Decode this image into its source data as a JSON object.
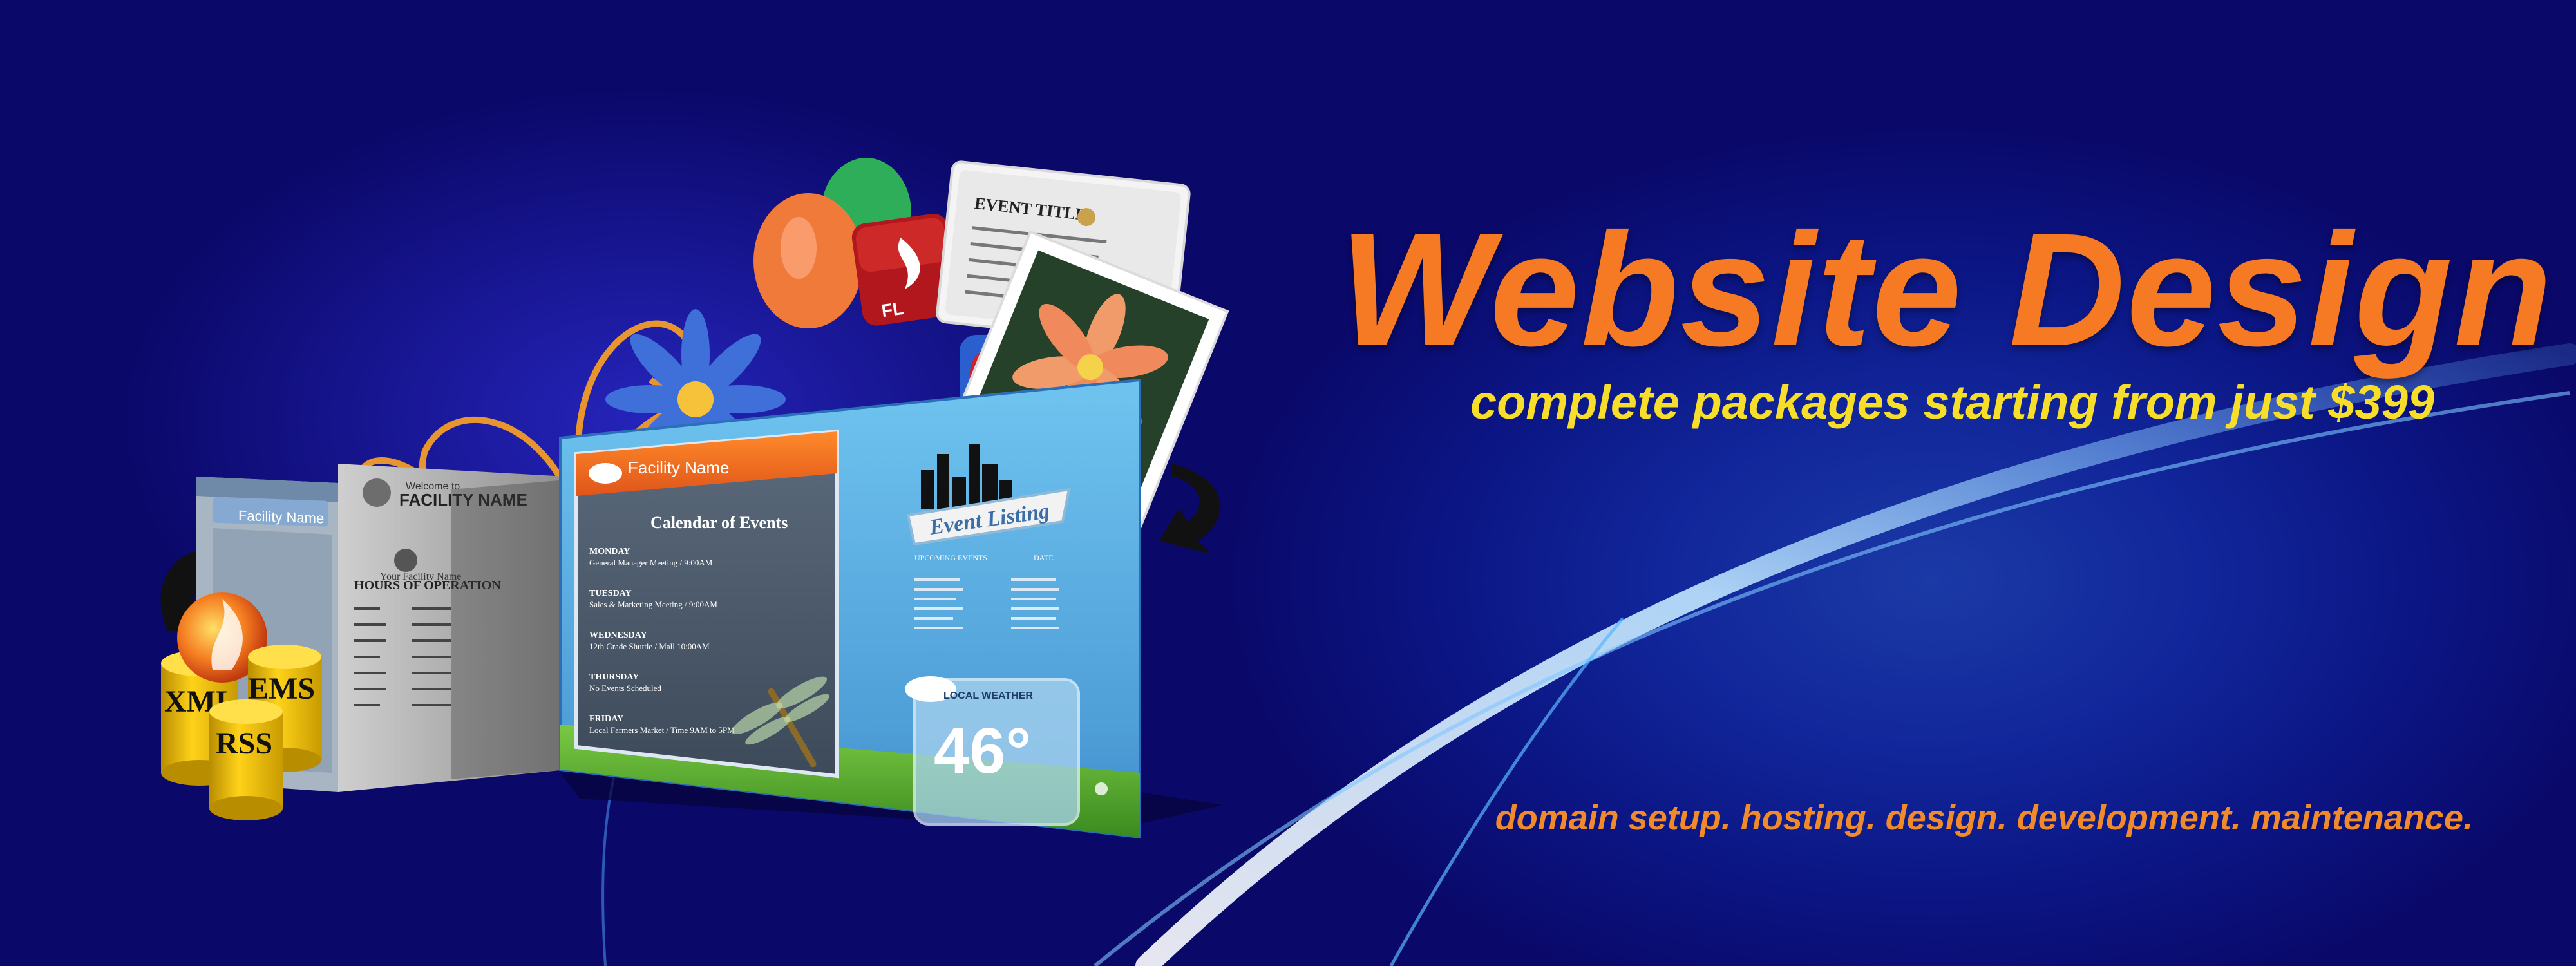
{
  "hero": {
    "headline": "Website Design",
    "subheadline": "complete packages starting from just $399",
    "services": "domain setup. hosting. design. development. maintenance."
  },
  "collage": {
    "tags": [
      "XML",
      "EMS",
      "RSS"
    ],
    "panel1": {
      "name": "Facility Name"
    },
    "panel2": {
      "welcome": "Welcome to",
      "name": "FACILITY NAME",
      "your_name": "Your Facility Name",
      "hours_title": "HOURS OF OPERATION"
    },
    "main_panel": {
      "name": "Facility Name",
      "calendar_title": "Calendar of Events",
      "days": [
        {
          "day": "MONDAY",
          "event": "General Manager Meeting / 9:00AM"
        },
        {
          "day": "TUESDAY",
          "event": "Sales & Marketing Meeting / 9:00AM"
        },
        {
          "day": "WEDNESDAY",
          "event": "12th Grade Shuttle / Mall 10:00AM"
        },
        {
          "day": "THURSDAY",
          "event": "No Events Scheduled"
        },
        {
          "day": "FRIDAY",
          "event": "Local Farmers Market / Time 9AM to 5PM"
        }
      ],
      "event_listing": "Event Listing",
      "upcoming_label": "UPCOMING EVENTS",
      "date_label": "DATE",
      "weather_label": "LOCAL WEATHER",
      "temperature": "46°"
    },
    "card": {
      "title": "EVENT TITLE"
    }
  },
  "colors": {
    "background": "#0a0868",
    "headline": "#f57a23",
    "subheadline": "#f6de2b",
    "services": "#f08a2a"
  }
}
